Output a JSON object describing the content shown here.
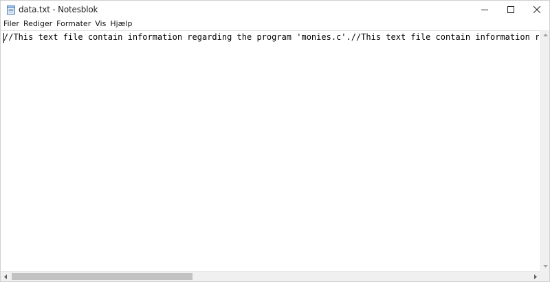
{
  "window": {
    "title": "data.txt - Notesblok"
  },
  "menu": {
    "items": [
      "Filer",
      "Rediger",
      "Formater",
      "Vis",
      "Hjælp"
    ]
  },
  "editor": {
    "content": "//This text file contain information regarding the program 'monies.c'.//This text file contain information regarding the program 'monies.c'."
  },
  "icons": {
    "app": "notepad-icon",
    "minimize": "minimize-icon",
    "maximize": "maximize-icon",
    "close": "close-icon"
  },
  "colors": {
    "background": "#ffffff",
    "scrollbar_track": "#f0f0f0",
    "scrollbar_thumb": "#c2c2c2"
  }
}
